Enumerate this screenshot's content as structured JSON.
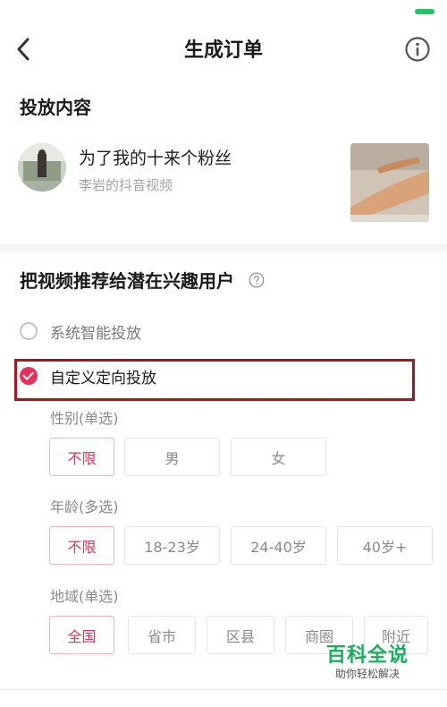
{
  "nav": {
    "title": "生成订单"
  },
  "content_section": {
    "title": "投放内容"
  },
  "video": {
    "title": "为了我的十来个粉丝",
    "author": "李岩的抖音视频"
  },
  "recommend": {
    "title": "把视频推荐给潜在兴趣用户",
    "options": [
      {
        "label": "系统智能投放",
        "checked": false
      },
      {
        "label": "自定义定向投放",
        "checked": true
      }
    ]
  },
  "gender": {
    "label": "性别(单选)",
    "options": [
      "不限",
      "男",
      "女"
    ],
    "selected": "不限"
  },
  "age": {
    "label": "年龄(多选)",
    "options": [
      "不限",
      "18-23岁",
      "24-40岁",
      "40岁+"
    ],
    "selected": "不限"
  },
  "region": {
    "label": "地域(单选)",
    "options": [
      "全国",
      "省市",
      "区县",
      "商圈",
      "附近"
    ],
    "selected": "全国"
  },
  "watermark": {
    "title": "百科全说",
    "subtitle": "助你轻松解决"
  },
  "colors": {
    "accent": "#e8315a",
    "highlight_border": "#a8141f",
    "watermark_green": "#1aaf5d",
    "battery": "#22c55e"
  }
}
